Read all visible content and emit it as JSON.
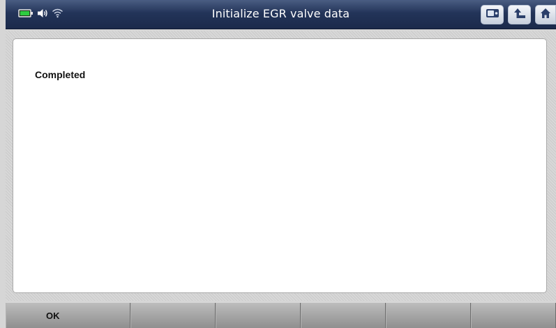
{
  "header": {
    "title": "Initialize EGR valve data",
    "status_icons": [
      "battery-icon",
      "speaker-icon",
      "wifi-icon"
    ],
    "buttons": [
      "screenshot-icon",
      "back-arrow-icon",
      "home-icon"
    ]
  },
  "content": {
    "message": "Completed"
  },
  "footer": {
    "softkeys": [
      "OK",
      "",
      "",
      "",
      "",
      ""
    ]
  },
  "colors": {
    "titlebar": "#233459",
    "battery": "#2ecc40",
    "content_bg": "#ffffff",
    "softkey": "#a3a3a3"
  }
}
